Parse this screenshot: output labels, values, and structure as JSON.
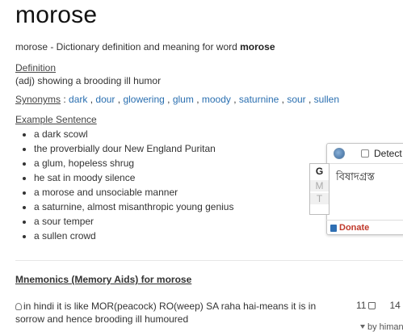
{
  "entry": {
    "word": "morose",
    "intro_prefix": "morose - Dictionary definition and meaning for word ",
    "intro_word": "morose"
  },
  "definition": {
    "label": "Definition",
    "text": "(adj) showing a brooding ill humor"
  },
  "synonyms": {
    "label": "Synonyms",
    "separator": " : ",
    "items": [
      "dark",
      "dour",
      "glowering",
      "glum",
      "moody",
      "saturnine",
      "sour",
      "sullen"
    ],
    "link_color": "#2a6fb0"
  },
  "examples": {
    "label": "Example Sentence",
    "items": [
      "a dark scowl",
      "the proverbially dour New England Puritan",
      "a glum, hopeless shrug",
      "he sat in moody silence",
      "a morose and unsociable manner",
      "a saturnine, almost misanthropic young genius",
      "a sour temper",
      "a sullen crowd"
    ]
  },
  "mnemonics": {
    "heading": "Mnemonics (Memory Aids) for morose",
    "items": [
      {
        "icon": "lightbulb-icon",
        "text": "in hindi it is like MOR(peacock) RO(weep) SA raha hai-means it is in sorrow and hence brooding ill humoured",
        "likes": "11",
        "next_count": "14",
        "byline": "by himan"
      }
    ]
  },
  "translator_popup": {
    "detect_label": "Detect",
    "translation": "বিষাদগ্রস্ত",
    "tabs": [
      "G",
      "M",
      "T"
    ],
    "donate_label": "Donate",
    "donate_color": "#c0392b"
  }
}
